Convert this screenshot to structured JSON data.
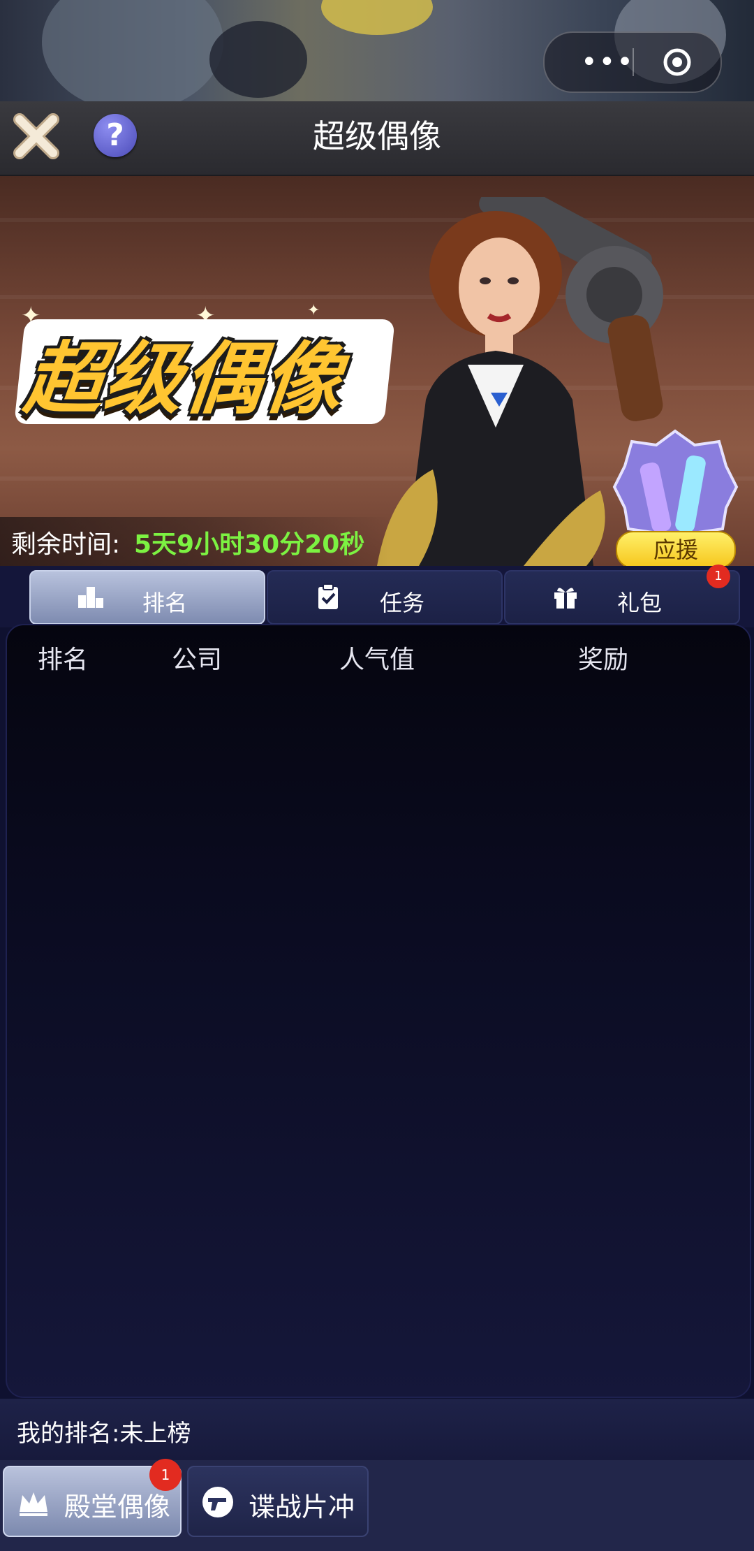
{
  "capsule": {
    "more_icon": "more-dots-icon",
    "close_icon": "target-circle-icon"
  },
  "header": {
    "title": "超级偶像",
    "close_icon": "close-x-icon",
    "help_icon": "question-icon",
    "help_glyph": "?"
  },
  "banner": {
    "logo_text": "超级偶像",
    "timer_label": "剩余时间:",
    "timer_value": "5天9小时30分20秒",
    "support_label": "应援"
  },
  "tabs": [
    {
      "label": "排名",
      "icon": "podium-icon",
      "active": true
    },
    {
      "label": "任务",
      "icon": "clipboard-check-icon",
      "active": false
    },
    {
      "label": "礼包",
      "icon": "gift-icon",
      "active": false,
      "badge": "1"
    }
  ],
  "ranking": {
    "columns": [
      "排名",
      "公司",
      "人气值",
      "奖励"
    ],
    "rows": []
  },
  "my_rank": {
    "label": "我的排名:未上榜"
  },
  "bottom_nav": [
    {
      "label": "殿堂偶像",
      "icon": "crown-icon",
      "active": true,
      "badge": "1"
    },
    {
      "label": "谍战片冲",
      "icon": "gun-icon",
      "active": false
    }
  ],
  "colors": {
    "timer_green": "#7cf242",
    "badge_red": "#e22b20",
    "logo_gold": "#ffc531",
    "panel_bg": "#0b0c22"
  }
}
